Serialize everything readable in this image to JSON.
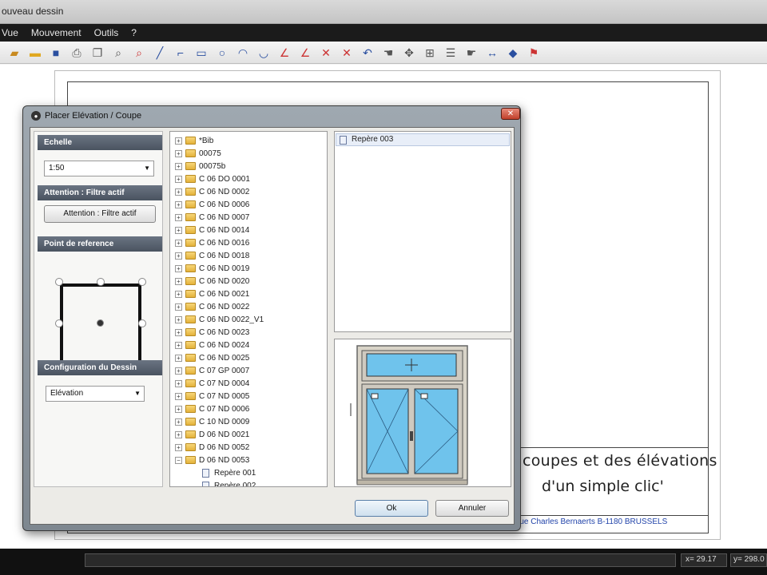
{
  "window": {
    "title": "ouveau dessin"
  },
  "menu": [
    "Vue",
    "Mouvement",
    "Outils",
    "?"
  ],
  "drawing": {
    "caption_line1": "coupes et des élévations",
    "caption_line2": "d'un simple clic'",
    "address": "rue Charles Bernaerts B-1180 BRUSSELS"
  },
  "status": {
    "x": "x= 29.17",
    "y": "y= 298.0"
  },
  "dialog": {
    "title": "Placer Elévation / Coupe",
    "echelle_header": "Echelle",
    "echelle_value": "1:50",
    "attention_header": "Attention : Filtre actif",
    "attention_button": "Attention : Filtre actif",
    "reference_header": "Point de reference",
    "config_header": "Configuration du Dessin",
    "config_value": "Elévation",
    "ok_label": "Ok",
    "cancel_label": "Annuler"
  },
  "tree": [
    {
      "label": "*Bib",
      "type": "folder"
    },
    {
      "label": "00075",
      "type": "folder"
    },
    {
      "label": "00075b",
      "type": "folder"
    },
    {
      "label": "C 06 DO 0001",
      "type": "folder"
    },
    {
      "label": "C 06 ND 0002",
      "type": "folder"
    },
    {
      "label": "C 06 ND 0006",
      "type": "folder"
    },
    {
      "label": "C 06 ND 0007",
      "type": "folder"
    },
    {
      "label": "C 06 ND 0014",
      "type": "folder"
    },
    {
      "label": "C 06 ND 0016",
      "type": "folder"
    },
    {
      "label": "C 06 ND 0018",
      "type": "folder"
    },
    {
      "label": "C 06 ND 0019",
      "type": "folder"
    },
    {
      "label": "C 06 ND 0020",
      "type": "folder"
    },
    {
      "label": "C 06 ND 0021",
      "type": "folder"
    },
    {
      "label": "C 06 ND 0022",
      "type": "folder"
    },
    {
      "label": "C 06 ND 0022_V1",
      "type": "folder"
    },
    {
      "label": "C 06 ND 0023",
      "type": "folder"
    },
    {
      "label": "C 06 ND 0024",
      "type": "folder"
    },
    {
      "label": "C 06 ND 0025",
      "type": "folder"
    },
    {
      "label": "C 07 GP 0007",
      "type": "folder"
    },
    {
      "label": "C 07 ND 0004",
      "type": "folder"
    },
    {
      "label": "C 07 ND 0005",
      "type": "folder"
    },
    {
      "label": "C 07 ND 0006",
      "type": "folder"
    },
    {
      "label": "C 10 ND 0009",
      "type": "folder"
    },
    {
      "label": "D 06 ND 0021",
      "type": "folder"
    },
    {
      "label": "D 06 ND 0052",
      "type": "folder"
    },
    {
      "label": "D 06 ND 0053",
      "type": "folder-open"
    },
    {
      "label": "Repère 001",
      "type": "doc"
    },
    {
      "label": "Repère 002",
      "type": "doc"
    }
  ],
  "list": {
    "selected_item": "Repère 003"
  },
  "colors": {
    "menubar": "#1b1b1b",
    "dialog_frame": "#8a939c",
    "section_header": "#5a6370",
    "glass": "#6fc3ec"
  }
}
